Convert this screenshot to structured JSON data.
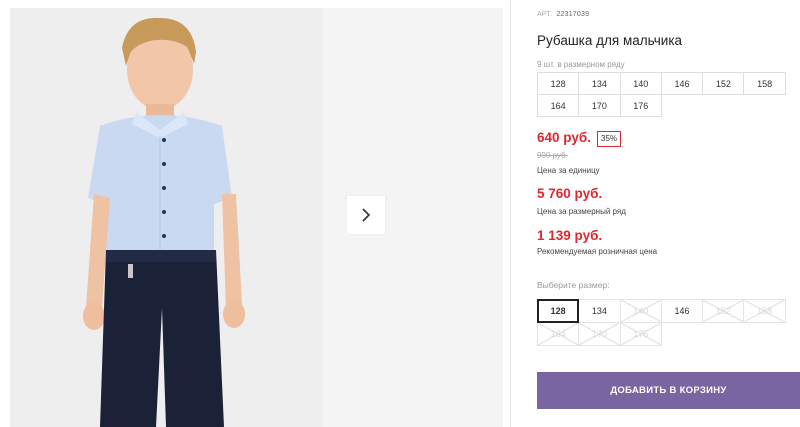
{
  "product": {
    "sku_label": "АРТ.",
    "sku_value": "22317039",
    "title": "Рубашка для мальчика",
    "set_note": "9 шт. в размерном ряду",
    "set_sizes": [
      [
        "128",
        "134",
        "140",
        "146",
        "152",
        "158"
      ],
      [
        "164",
        "170",
        "176"
      ]
    ]
  },
  "pricing": {
    "price": "640 руб.",
    "discount": "35%",
    "old_price": "990 руб.",
    "unit_caption": "Цена за единицу",
    "set_price": "5 760 руб.",
    "set_caption": "Цена за размерный ряд",
    "rrp_price": "1 139 руб.",
    "rrp_caption": "Рекомендуемая розничная цена"
  },
  "size_picker": {
    "label": "Выберите размер:",
    "options": [
      {
        "label": "128",
        "state": "selected"
      },
      {
        "label": "134",
        "state": "available"
      },
      {
        "label": "140",
        "state": "unavailable"
      },
      {
        "label": "146",
        "state": "available"
      },
      {
        "label": "152",
        "state": "unavailable"
      },
      {
        "label": "158",
        "state": "unavailable"
      },
      {
        "label": "164",
        "state": "unavailable"
      },
      {
        "label": "170",
        "state": "unavailable"
      },
      {
        "label": "176",
        "state": "unavailable"
      }
    ]
  },
  "cart": {
    "button_label": "ДОБАВИТЬ В КОРЗИНУ",
    "button_color": "#7a65a3"
  },
  "colors": {
    "price_red": "#e0262f",
    "shirt_blue": "#c9d9f2",
    "pants_navy": "#1b2238"
  },
  "gallery": {
    "next_icon": "chevron-right-icon"
  }
}
